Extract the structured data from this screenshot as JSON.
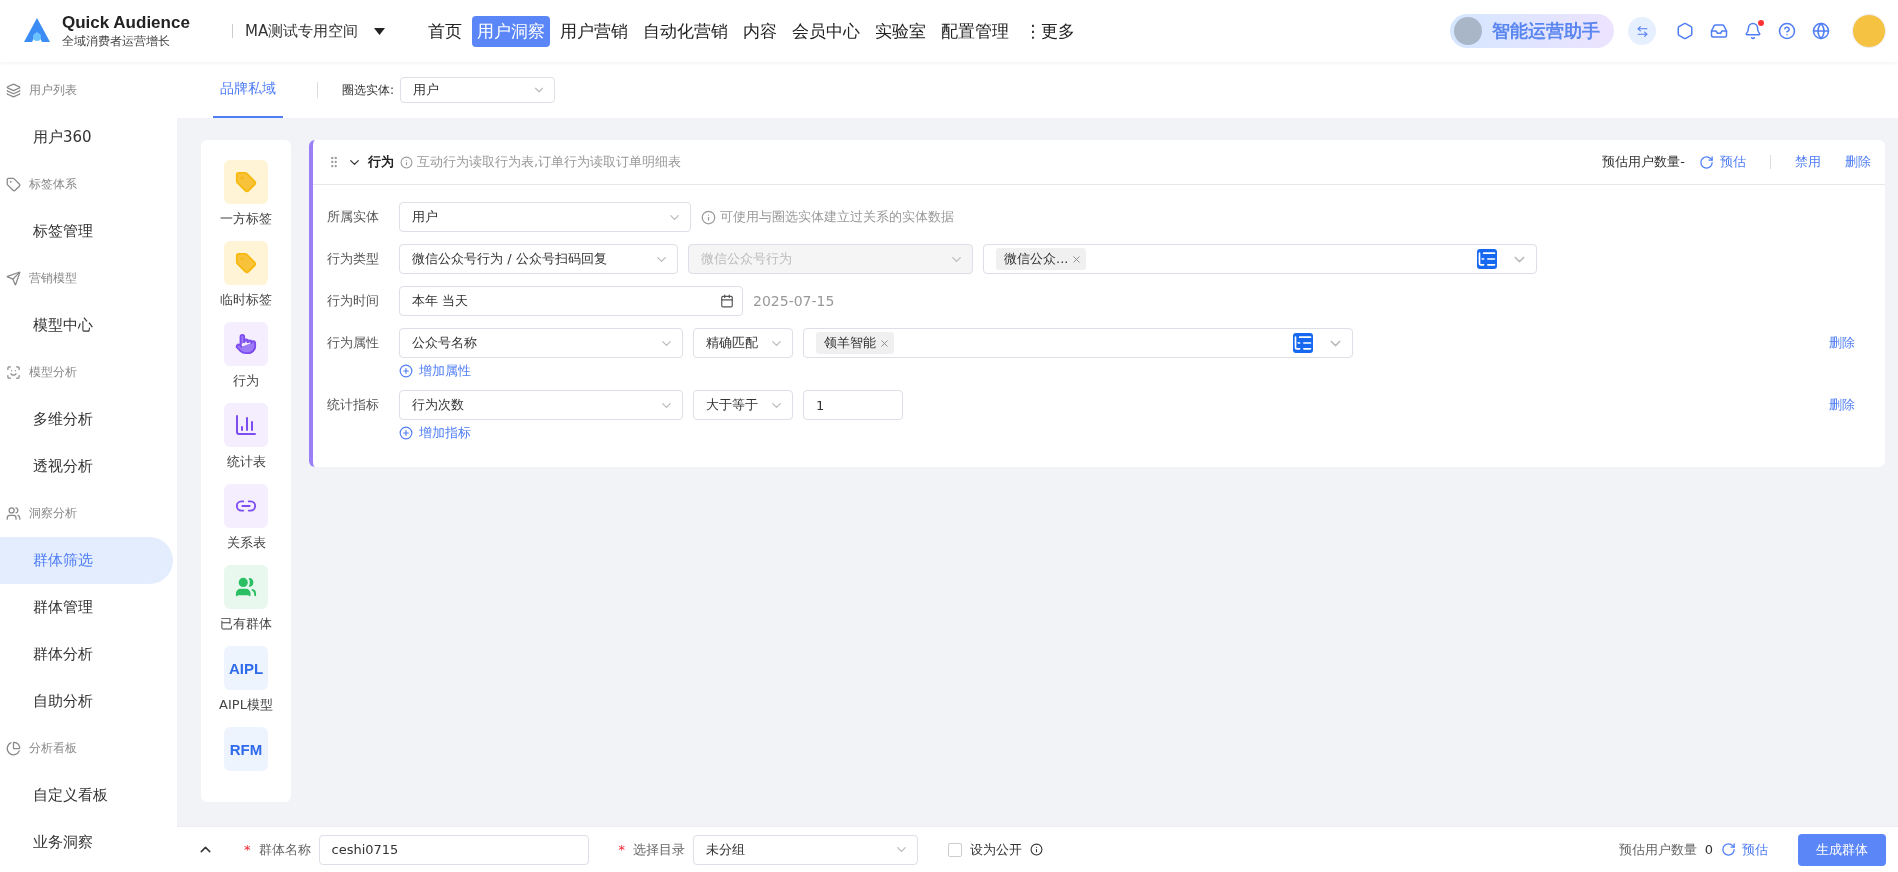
{
  "header": {
    "logo_title": "Quick Audience",
    "logo_subtitle": "全域消费者运营增长",
    "workspace": "MA测试专用空间",
    "nav": [
      {
        "label": "首页",
        "selected": false
      },
      {
        "label": "用户洞察",
        "selected": true
      },
      {
        "label": "用户营销",
        "selected": false
      },
      {
        "label": "自动化营销",
        "selected": false
      },
      {
        "label": "内容",
        "selected": false
      },
      {
        "label": "会员中心",
        "selected": false
      },
      {
        "label": "实验室",
        "selected": false
      },
      {
        "label": "配置管理",
        "selected": false
      },
      {
        "label": "⋮更多",
        "selected": false
      }
    ],
    "assistant": "智能运营助手",
    "has_notification": true
  },
  "sidebar": {
    "groups": [
      {
        "title": "用户列表",
        "items": [
          {
            "label": "用户360",
            "selected": false
          }
        ]
      },
      {
        "title": "标签体系",
        "items": [
          {
            "label": "标签管理",
            "selected": false
          }
        ]
      },
      {
        "title": "营销模型",
        "items": [
          {
            "label": "模型中心",
            "selected": false
          }
        ]
      },
      {
        "title": "模型分析",
        "items": [
          {
            "label": "多维分析",
            "selected": false
          },
          {
            "label": "透视分析",
            "selected": false
          }
        ]
      },
      {
        "title": "洞察分析",
        "items": [
          {
            "label": "群体筛选",
            "selected": true
          },
          {
            "label": "群体管理",
            "selected": false
          },
          {
            "label": "群体分析",
            "selected": false
          },
          {
            "label": "自助分析",
            "selected": false
          }
        ]
      },
      {
        "title": "分析看板",
        "items": [
          {
            "label": "自定义看板",
            "selected": false
          },
          {
            "label": "业务洞察",
            "selected": false
          }
        ]
      }
    ]
  },
  "tabs": [
    {
      "label": "品牌私域",
      "selected": true
    }
  ],
  "entity_filter": {
    "label": "圈选实体:",
    "value": "用户"
  },
  "palette": [
    {
      "kind": "tag",
      "label": "一方标签"
    },
    {
      "kind": "tag-clock",
      "label": "临时标签"
    },
    {
      "kind": "hand",
      "label": "行为"
    },
    {
      "kind": "bars",
      "label": "统计表"
    },
    {
      "kind": "link",
      "label": "关系表"
    },
    {
      "kind": "group",
      "label": "已有群体"
    },
    {
      "kind": "text",
      "badge": "AIPL",
      "label": "AIPL模型"
    },
    {
      "kind": "text",
      "badge": "RFM"
    }
  ],
  "rule": {
    "title": "行为",
    "hint": "互动行为读取行为表,订单行为读取订单明细表",
    "estimate_label": "预估用户数量-",
    "estimate_link": "预估",
    "actions": [
      "禁用",
      "删除"
    ],
    "rows": [
      {
        "label": "所属实体",
        "fields": [
          {
            "kind": "select",
            "value": "用户",
            "disabled": false
          },
          {
            "kind": "hint",
            "value": "可使用与圈选实体建立过关系的实体数据"
          }
        ]
      },
      {
        "label": "行为类型",
        "fields": [
          {
            "kind": "select",
            "value": "微信公众号行为 / 公众号扫码回复",
            "disabled": false
          },
          {
            "kind": "select",
            "placeholder": "微信公众号行为",
            "disabled": true
          },
          {
            "kind": "tags",
            "tags": [
              "微信公众..."
            ]
          }
        ]
      },
      {
        "label": "行为时间",
        "fields": [
          {
            "kind": "date",
            "value": "本年 当天"
          },
          {
            "kind": "note",
            "value": "2025-07-15"
          }
        ]
      },
      {
        "label": "行为属性",
        "fields": [
          {
            "kind": "select",
            "value": "公众号名称",
            "disabled": false
          },
          {
            "kind": "select",
            "value": "精确匹配",
            "disabled": false
          },
          {
            "kind": "tags",
            "tags": [
              "领羊智能"
            ]
          }
        ],
        "delete": "删除",
        "add": "增加属性"
      },
      {
        "label": "统计指标",
        "fields": [
          {
            "kind": "select",
            "value": "行为次数",
            "disabled": false
          },
          {
            "kind": "select",
            "value": "大于等于",
            "disabled": false
          },
          {
            "kind": "input",
            "value": "1"
          }
        ],
        "delete": "删除",
        "add": "增加指标"
      }
    ]
  },
  "footer": {
    "name": {
      "mark": "*",
      "label": "群体名称",
      "value": "ceshi0715"
    },
    "directory": {
      "mark": "*",
      "label": "选择目录",
      "value": "未分组"
    },
    "public": {
      "label": "设为公开",
      "checked": false
    },
    "estimate_label": "预估用户数量",
    "count": "0",
    "estimate_link": "预估",
    "submit": "生成群体"
  }
}
